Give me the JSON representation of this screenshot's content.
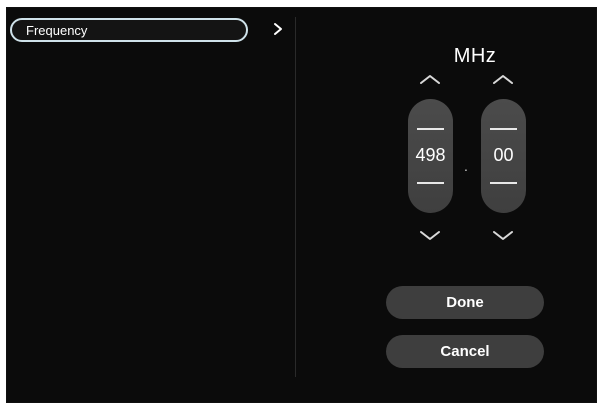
{
  "sidebar": {
    "items": [
      {
        "label": "Frequency",
        "icon": "chevron-right-icon"
      }
    ]
  },
  "frequency": {
    "unit": "MHz",
    "integer_part": "498",
    "separator": ".",
    "decimal_part": "00"
  },
  "actions": {
    "done_label": "Done",
    "cancel_label": "Cancel"
  },
  "colors": {
    "background": "#0b0b0b",
    "focus_outline": "#cfe2ea",
    "spinner": "#454545",
    "button": "#3e3e3e",
    "text": "#ffffff"
  }
}
